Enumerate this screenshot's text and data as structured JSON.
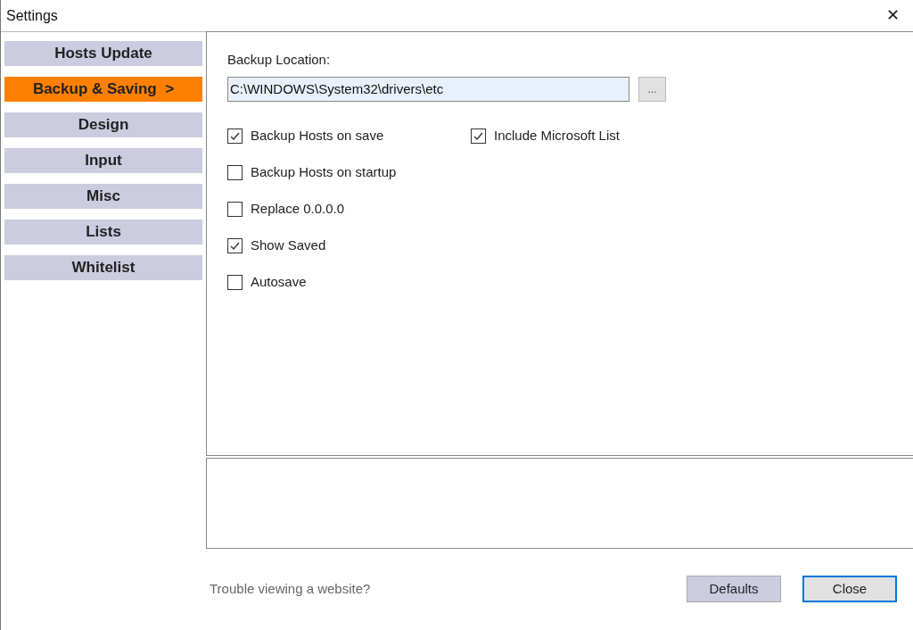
{
  "window": {
    "title": "Settings",
    "close": "✕"
  },
  "sidebar": {
    "items": [
      {
        "label": "Hosts Update",
        "selected": false
      },
      {
        "label": "Backup & Saving  >",
        "selected": true
      },
      {
        "label": "Design",
        "selected": false
      },
      {
        "label": "Input",
        "selected": false
      },
      {
        "label": "Misc",
        "selected": false
      },
      {
        "label": "Lists",
        "selected": false
      },
      {
        "label": "Whitelist",
        "selected": false
      }
    ]
  },
  "backup_location": {
    "label": "Backup Location:",
    "value": "C:\\WINDOWS\\System32\\drivers\\etc",
    "browse": "..."
  },
  "options_left": [
    {
      "label": "Backup Hosts on save",
      "checked": true
    },
    {
      "label": "Backup Hosts on startup",
      "checked": false
    },
    {
      "label": "Replace 0.0.0.0",
      "checked": false
    },
    {
      "label": "Show Saved",
      "checked": true
    },
    {
      "label": "Autosave",
      "checked": false
    }
  ],
  "options_right": [
    {
      "label": "Include Microsoft List",
      "checked": true
    }
  ],
  "footer": {
    "link": "Trouble viewing a website?",
    "buttons": [
      {
        "label": "Defaults",
        "kind": "secondary"
      },
      {
        "label": "Close",
        "kind": "default"
      }
    ]
  }
}
